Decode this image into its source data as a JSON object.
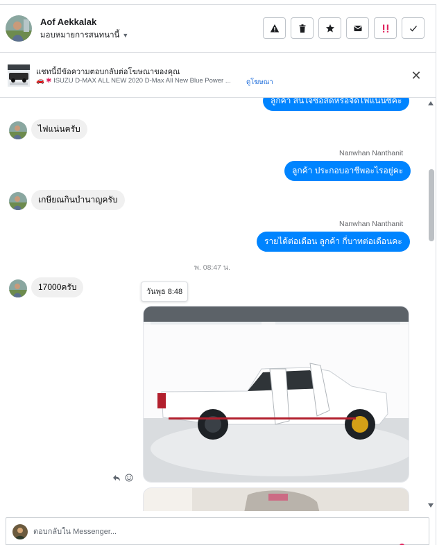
{
  "header": {
    "user_name": "Aof Aekkalak",
    "assign_label": "มอบหมายการสนทนานี้",
    "actions": [
      {
        "name": "report-spam-button",
        "icon": "warning-triangle-icon"
      },
      {
        "name": "delete-button",
        "icon": "trash-icon"
      },
      {
        "name": "star-button",
        "icon": "star-icon"
      },
      {
        "name": "mark-unread-button",
        "icon": "envelope-icon"
      },
      {
        "name": "follow-up-button",
        "icon": "exclamation-icon"
      },
      {
        "name": "mark-done-button",
        "icon": "checkmark-icon"
      }
    ]
  },
  "ad_banner": {
    "title": "แชทนี้มีข้อความตอบกลับต่อโฆษณาของคุณ",
    "ad_text": "ISUZU D-MAX ALL NEW 2020 D-Max All New Blue Power ...",
    "ad_emoji": "🚗 ✱",
    "view_ad_link": "ดูโฆษณา",
    "close_icon": "close-icon"
  },
  "messages": {
    "out_1": "ลูกค้า สนใจซื้อสดหรือจัดไฟแนนซ์คะ",
    "in_1": "ไฟแน่นครับ",
    "sender_2": "Nanwhan Nanthanit",
    "out_2": "ลูกค้า ประกอบอาชีพอะไรอยู่คะ",
    "in_2": "เกษียณกินบำนาญครับ",
    "sender_3": "Nanwhan Nanthanit",
    "out_3": "รายได้ต่อเดือน ลูกค้า กี่บาทต่อเดือนคะ",
    "timestamp": "พ. 08:47 น.",
    "in_3": "17000ครับ",
    "tooltip": "วันพุธ 8:48"
  },
  "composer": {
    "placeholder": "ตอบกลับใน Messenger..."
  },
  "colors": {
    "outgoing_bubble": "#0084ff",
    "incoming_bubble": "#f0f0f0",
    "follow_up_red": "#e0245e",
    "link_blue": "#216fdb"
  }
}
